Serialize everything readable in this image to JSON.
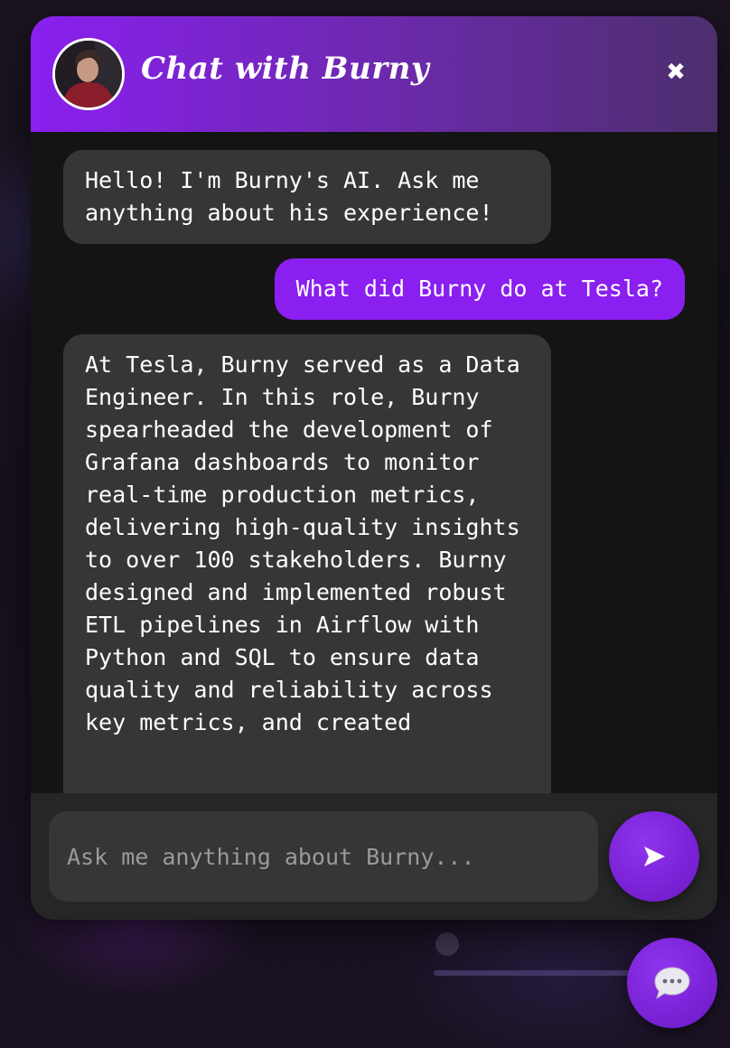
{
  "header": {
    "title": "Chat with Burny",
    "avatar_icon": "profile-photo",
    "close_icon": "✖"
  },
  "messages": [
    {
      "role": "bot",
      "text": "Hello! I'm Burny's AI. Ask me anything about his experience!"
    },
    {
      "role": "user",
      "text": "What did Burny do at Tesla?"
    },
    {
      "role": "bot",
      "text": "At Tesla, Burny served as a Data Engineer. In this role, Burny spearheaded the development of Grafana dashboards to monitor real-time production metrics, delivering high-quality insights to over 100 stakeholders. Burny designed and implemented robust ETL pipelines in Airflow with Python and SQL to ensure data quality and reliability across key metrics, and created"
    }
  ],
  "input": {
    "placeholder": "Ask me anything about Burny...",
    "value": ""
  },
  "send_button": {
    "icon": "send-arrow-icon"
  },
  "launcher_button": {
    "icon": "chat-bubble-icon"
  },
  "colors": {
    "accent": "#8a1ff0",
    "header_gradient_end": "#4d2f6e",
    "panel": "#141414",
    "bubble_bot": "#363636",
    "input_bar": "#262626"
  }
}
